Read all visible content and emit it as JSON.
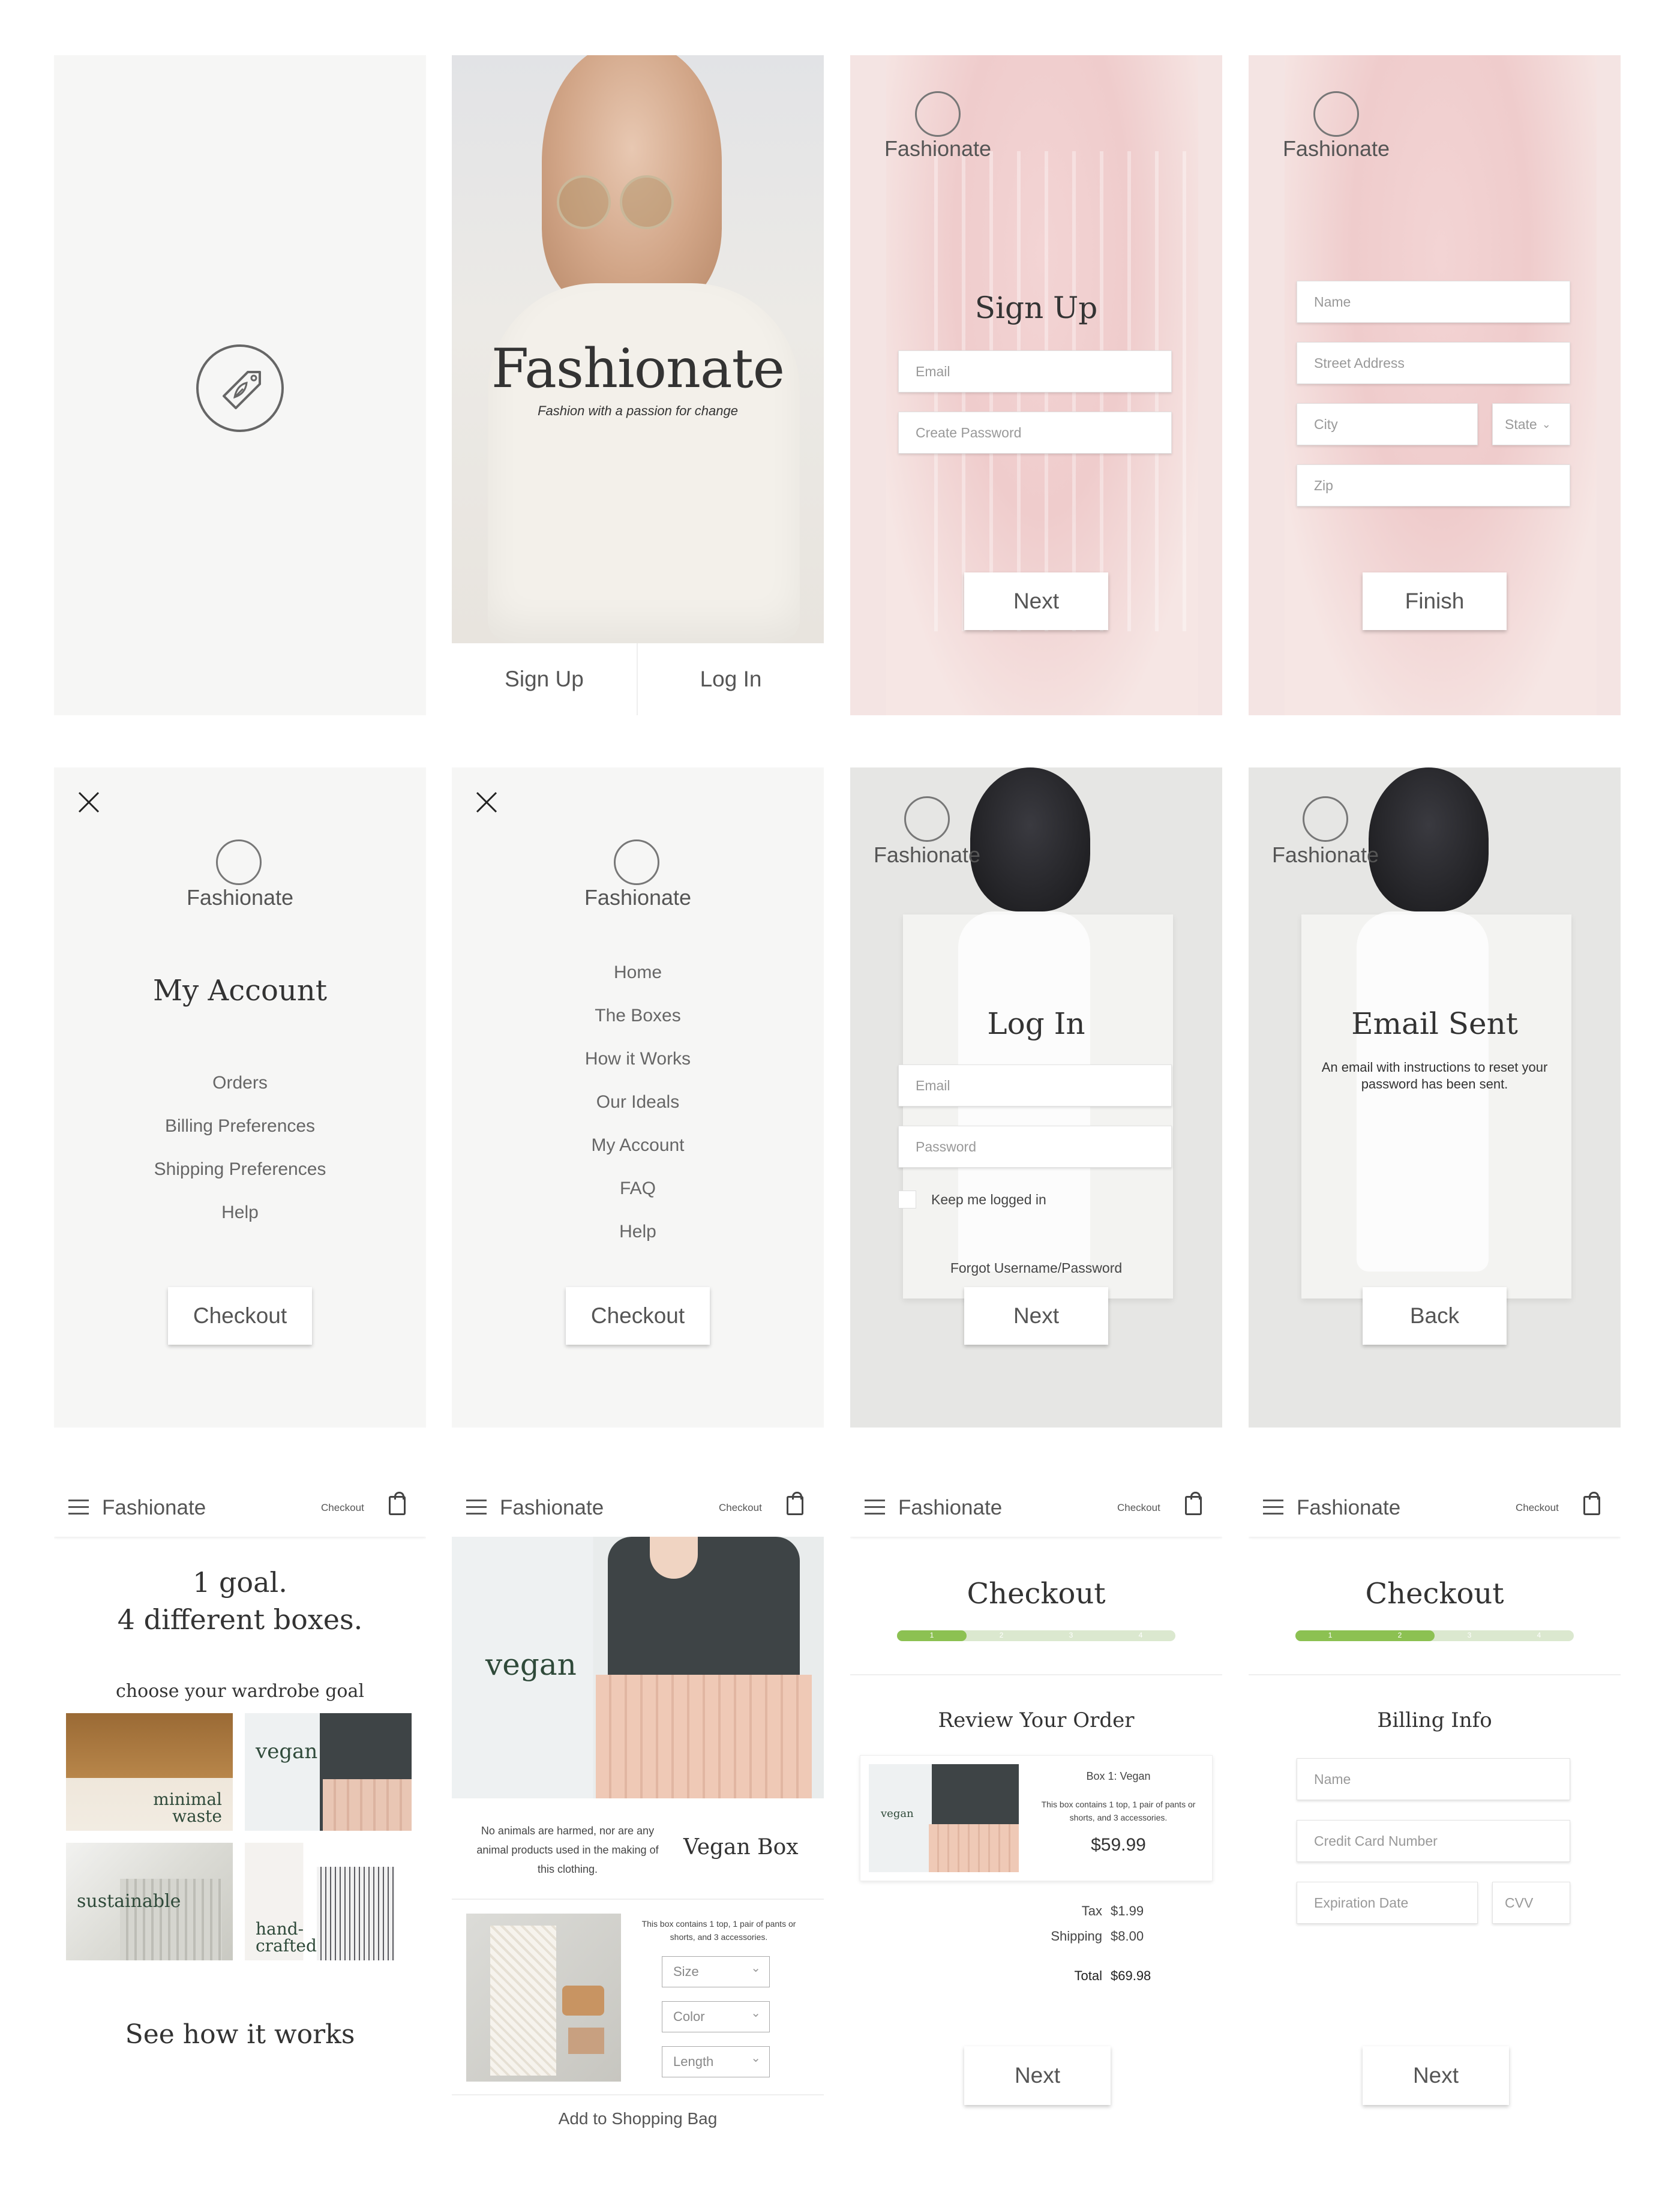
{
  "brand": {
    "name": "Fashionate",
    "tagline": "Fashion with a passion for change"
  },
  "welcome": {
    "signup_label": "Sign Up",
    "login_label": "Log In"
  },
  "signup": {
    "title": "Sign Up",
    "email_placeholder": "Email",
    "password_placeholder": "Create Password",
    "next_label": "Next"
  },
  "address": {
    "name_placeholder": "Name",
    "street_placeholder": "Street Address",
    "city_placeholder": "City",
    "state_label": "State",
    "zip_placeholder": "Zip",
    "finish_label": "Finish"
  },
  "account_menu": {
    "title": "My Account",
    "items": [
      "Orders",
      "Billing Preferences",
      "Shipping Preferences",
      "Help"
    ],
    "checkout_label": "Checkout"
  },
  "main_menu": {
    "items": [
      "Home",
      "The Boxes",
      "How it Works",
      "Our Ideals",
      "My Account",
      "FAQ",
      "Help"
    ],
    "checkout_label": "Checkout"
  },
  "login": {
    "title": "Log In",
    "email_placeholder": "Email",
    "password_placeholder": "Password",
    "keep_logged_in": "Keep me logged in",
    "forgot_label": "Forgot Username/Password",
    "next_label": "Next"
  },
  "email_sent": {
    "title": "Email Sent",
    "message": "An email with instructions to reset your password has been sent.",
    "back_label": "Back"
  },
  "header": {
    "checkout_label": "Checkout"
  },
  "boxes": {
    "headline_1": "1 goal.",
    "headline_2": "4 different boxes.",
    "subhead": "choose your wardrobe goal",
    "tiles": [
      "minimal waste",
      "vegan",
      "sustainable",
      "hand-crafted"
    ],
    "cta": "See how it works"
  },
  "vegan_box": {
    "hero_label": "vegan",
    "description": "No animals are harmed, nor are any animal products used in the making of this clothing.",
    "title": "Vegan Box",
    "contents": "This box contains 1 top, 1 pair of pants or shorts, and 3 accessories.",
    "size_label": "Size",
    "color_label": "Color",
    "length_label": "Length",
    "add_label": "Add to Shopping Bag"
  },
  "review": {
    "title": "Checkout",
    "steps": [
      "1",
      "2",
      "3",
      "4"
    ],
    "current_step": 1,
    "section": "Review Your Order",
    "item_thumb_label": "vegan",
    "item_name": "Box 1: Vegan",
    "item_desc": "This box contains 1 top, 1 pair of pants or shorts, and 3 accessories.",
    "item_price": "$59.99",
    "tax_label": "Tax",
    "tax_value": "$1.99",
    "shipping_label": "Shipping",
    "shipping_value": "$8.00",
    "total_label": "Total",
    "total_value": "$69.98",
    "next_label": "Next"
  },
  "billing": {
    "title": "Checkout",
    "steps": [
      "1",
      "2",
      "3",
      "4"
    ],
    "current_step": 2,
    "section": "Billing Info",
    "name_placeholder": "Name",
    "card_placeholder": "Credit Card Number",
    "expiry_placeholder": "Expiration Date",
    "cvv_placeholder": "CVV",
    "next_label": "Next"
  },
  "colors": {
    "accent_green": "#8cc152",
    "progress_track": "#dbe8cf",
    "dark_green_text": "#2f4a3a",
    "pink_dress": "#f0d3d3",
    "background": "#f6f6f5"
  }
}
